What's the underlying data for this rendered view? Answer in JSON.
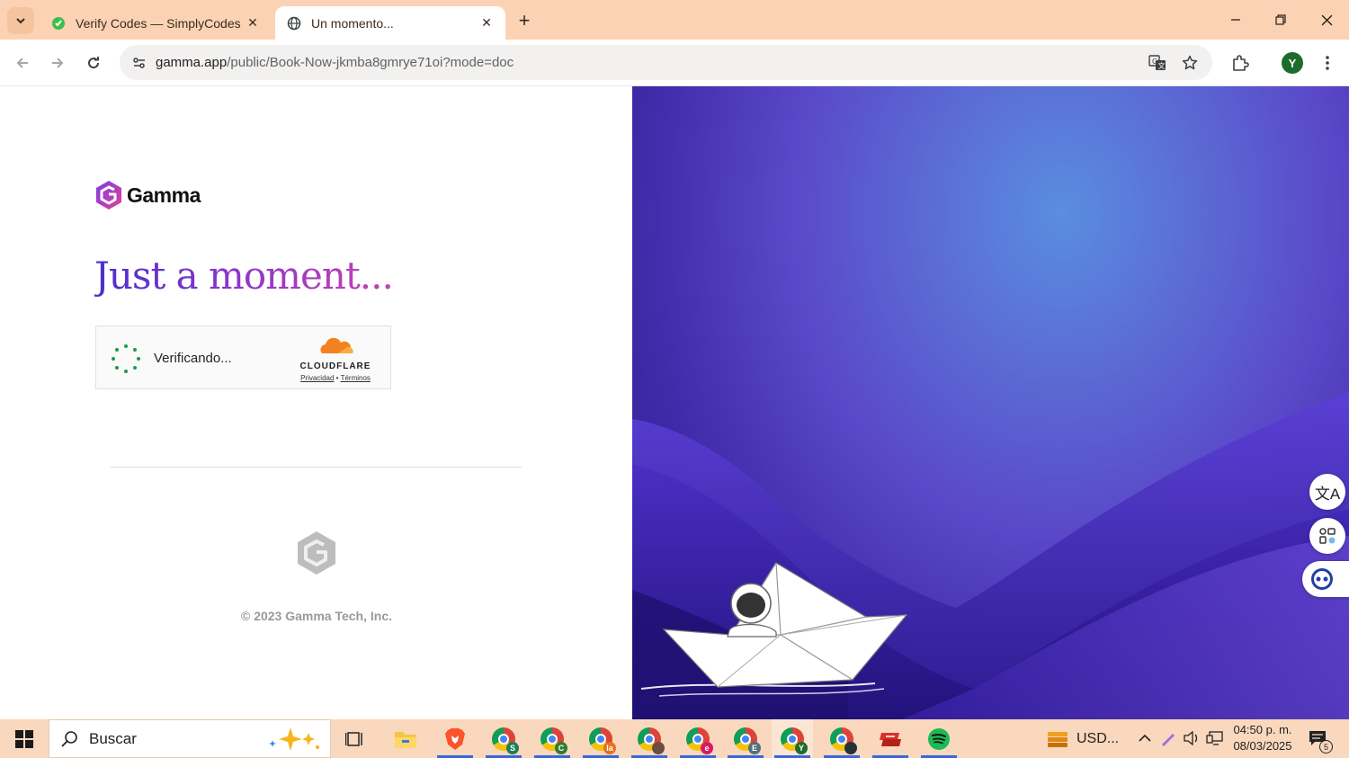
{
  "browser": {
    "tabs": [
      {
        "title": "Verify Codes — SimplyCodes",
        "active": false
      },
      {
        "title": "Un momento...",
        "active": true
      }
    ],
    "url_host": "gamma.app",
    "url_path": "/public/Book-Now-jkmba8gmrye71oi?mode=doc",
    "profile_initial": "Y"
  },
  "page": {
    "logo_text": "Gamma",
    "headline": "Just a moment...",
    "verification": {
      "status": "Verificando...",
      "brand": "CLOUDFLARE",
      "privacy_link": "Privacidad",
      "separator": "•",
      "terms_link": "Términos"
    },
    "copyright": "© 2023 Gamma Tech, Inc."
  },
  "taskbar": {
    "search_placeholder": "Buscar",
    "stock_label": "USD...",
    "time": "04:50 p. m.",
    "date": "08/03/2025",
    "notification_count": "5",
    "chrome_profiles": [
      "S",
      "C",
      "la",
      "",
      "e",
      "E",
      "Y",
      ""
    ]
  },
  "colors": {
    "tab_strip": "#fbd3b4",
    "taskbar": "#f9d8bd",
    "headline_gradient_start": "#4b2fcf",
    "headline_gradient_end": "#c544b2"
  }
}
